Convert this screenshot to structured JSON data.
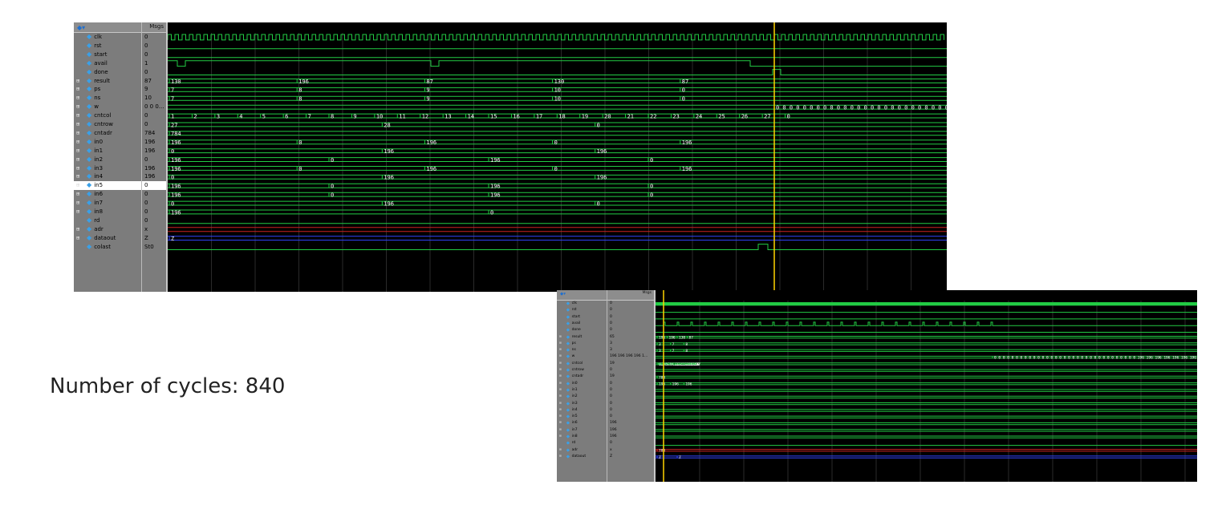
{
  "caption": "Number of cycles: 840",
  "colors": {
    "wave_bg": "#000000",
    "trace": "#22cc44",
    "bus": "#b8f5b0",
    "cursor": "#ffd400",
    "z_trace": "#3344ff"
  },
  "panel1": {
    "msgs_label": "Msgs",
    "signals": [
      {
        "name": "clk",
        "value": "0",
        "bus": false
      },
      {
        "name": "rst",
        "value": "0",
        "bus": false
      },
      {
        "name": "start",
        "value": "0",
        "bus": false
      },
      {
        "name": "avail",
        "value": "1",
        "bus": false
      },
      {
        "name": "done",
        "value": "0",
        "bus": false
      },
      {
        "name": "result",
        "value": "87",
        "bus": true
      },
      {
        "name": "ps",
        "value": "9",
        "bus": true
      },
      {
        "name": "ns",
        "value": "10",
        "bus": true
      },
      {
        "name": "w",
        "value": "0 0 0...",
        "bus": true
      },
      {
        "name": "cntcol",
        "value": "0",
        "bus": true
      },
      {
        "name": "cntrow",
        "value": "0",
        "bus": true
      },
      {
        "name": "cntadr",
        "value": "784",
        "bus": true
      },
      {
        "name": "in0",
        "value": "196",
        "bus": true
      },
      {
        "name": "in1",
        "value": "196",
        "bus": true
      },
      {
        "name": "in2",
        "value": "0",
        "bus": true
      },
      {
        "name": "in3",
        "value": "196",
        "bus": true
      },
      {
        "name": "in4",
        "value": "196",
        "bus": true
      },
      {
        "name": "in5",
        "value": "0",
        "bus": true
      },
      {
        "name": "in6",
        "value": "0",
        "bus": true
      },
      {
        "name": "in7",
        "value": "0",
        "bus": true
      },
      {
        "name": "in8",
        "value": "0",
        "bus": true
      },
      {
        "name": "rd",
        "value": "0",
        "bus": false
      },
      {
        "name": "adr",
        "value": "x",
        "bus": true
      },
      {
        "name": "dataout",
        "value": "Z",
        "bus": true
      },
      {
        "name": "colast",
        "value": "St0",
        "bus": false
      }
    ],
    "bus_labels": {
      "result": [
        "130",
        "196",
        "87",
        "130",
        "87"
      ],
      "ps": [
        "7",
        "8",
        "9",
        "10",
        "0"
      ],
      "ns": [
        "7",
        "8",
        "9",
        "10",
        "0"
      ],
      "w": [
        "0 0 0 0 0 0 0 0 0 0 0 0 0 0 0 0 0 0 0 0 0 0 0 0 0 0 0 0 0 0 0 0 0 196 196 196 196 196 196 196 196 196 196"
      ],
      "cntcol": [
        "1",
        "2",
        "3",
        "4",
        "5",
        "6",
        "7",
        "8",
        "9",
        "10",
        "11",
        "12",
        "13",
        "14",
        "15",
        "16",
        "17",
        "18",
        "19",
        "20",
        "21",
        "22",
        "23",
        "24",
        "25",
        "26",
        "27",
        "0"
      ],
      "cntrow": [
        "27",
        "28",
        "0"
      ],
      "cntadr": [
        "784"
      ],
      "in0": [
        "196",
        "0",
        "196",
        "0",
        "196"
      ],
      "in1": [
        "0",
        "196",
        "196"
      ],
      "in2": [
        "196",
        "0",
        "196",
        "0"
      ],
      "in3": [
        "196",
        "0",
        "196",
        "0",
        "196"
      ],
      "in4": [
        "0",
        "196",
        "196"
      ],
      "in5": [
        "196",
        "0",
        "196",
        "0"
      ],
      "in6": [
        "196",
        "0",
        "196",
        "0"
      ],
      "in7": [
        "0",
        "196",
        "0"
      ],
      "in8": [
        "196",
        "0"
      ],
      "dataout": [
        "Z"
      ]
    }
  },
  "panel2": {
    "msgs_label": "Msgs",
    "signals": [
      {
        "name": "clk",
        "value": "0",
        "bus": false
      },
      {
        "name": "rst",
        "value": "0",
        "bus": false
      },
      {
        "name": "start",
        "value": "0",
        "bus": false
      },
      {
        "name": "avail",
        "value": "0",
        "bus": false
      },
      {
        "name": "done",
        "value": "0",
        "bus": false
      },
      {
        "name": "result",
        "value": "65",
        "bus": true
      },
      {
        "name": "ps",
        "value": "3",
        "bus": true
      },
      {
        "name": "ns",
        "value": "3",
        "bus": true
      },
      {
        "name": "w",
        "value": "196 196 196 196 1...",
        "bus": true
      },
      {
        "name": "cntcol",
        "value": "19",
        "bus": true
      },
      {
        "name": "cntrow",
        "value": "0",
        "bus": true
      },
      {
        "name": "cntadr",
        "value": "19",
        "bus": true
      },
      {
        "name": "in0",
        "value": "0",
        "bus": true
      },
      {
        "name": "in1",
        "value": "0",
        "bus": true
      },
      {
        "name": "in2",
        "value": "0",
        "bus": true
      },
      {
        "name": "in3",
        "value": "0",
        "bus": true
      },
      {
        "name": "in4",
        "value": "0",
        "bus": true
      },
      {
        "name": "in5",
        "value": "0",
        "bus": true
      },
      {
        "name": "in6",
        "value": "196",
        "bus": true
      },
      {
        "name": "in7",
        "value": "196",
        "bus": true
      },
      {
        "name": "in8",
        "value": "196",
        "bus": true
      },
      {
        "name": "rd",
        "value": "0",
        "bus": false
      },
      {
        "name": "adr",
        "value": "x",
        "bus": true
      },
      {
        "name": "dataout",
        "value": "Z",
        "bus": true
      }
    ],
    "bus_labels": {
      "result": [
        "196",
        "196",
        "130",
        "87"
      ],
      "ps": [
        "3",
        "7",
        "8"
      ],
      "ns": [
        "3",
        "7",
        "8"
      ],
      "w": [
        "0 0 0 0 0 0 0 0 0 0 0 0 0 0 0 0 0 0 0 0 0 0 0 0 0 0 0 0 0 0 0 0 0 196 196 196 196 196 196 196 196 196 196..."
      ],
      "cntcol": [
        "0",
        "1",
        "2",
        "3",
        "4",
        "5",
        "6",
        "7",
        "8",
        "9",
        "10",
        "11",
        "12",
        "13",
        "14",
        "15",
        "16",
        "17",
        "18",
        "19",
        "20",
        "21",
        "22",
        "23",
        "24",
        "25",
        "26",
        "27",
        "0"
      ],
      "cntadr": [
        "784"
      ],
      "in0": [
        "196",
        "196",
        "196"
      ],
      "adr": [
        "783"
      ],
      "dataout": [
        "Z",
        "Z"
      ]
    }
  }
}
